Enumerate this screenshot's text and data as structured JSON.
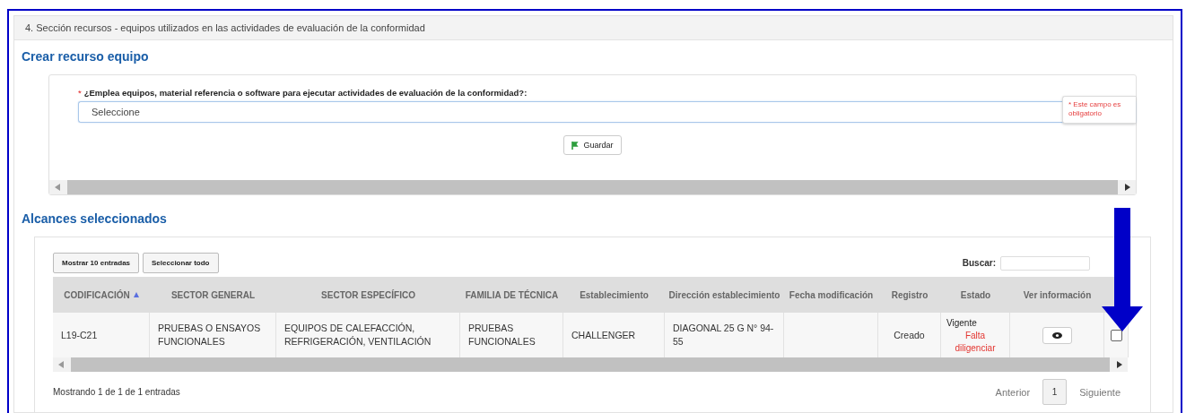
{
  "section": {
    "title": "4. Sección recursos - equipos utilizados en las actividades de evaluación de la conformidad"
  },
  "create": {
    "heading": "Crear recurso equipo",
    "question": {
      "label": "¿Emplea equipos, material referencia o software para ejecutar actividades de evaluación de la conformidad?:",
      "required": true,
      "required_mark": "*",
      "value": "Seleccione",
      "error": "* Este campo es obligatorio"
    },
    "save_button": "Guardar"
  },
  "scopes": {
    "heading": "Alcances seleccionados",
    "buttons": [
      "Mostrar 10 entradas",
      "Seleccionar todo"
    ],
    "search_label": "Buscar:",
    "columns": [
      {
        "label": "CODIFICACIÓN",
        "sorted": true
      },
      {
        "label": "SECTOR GENERAL",
        "sorted": false
      },
      {
        "label": "SECTOR ESPECÍFICO",
        "sorted": false
      },
      {
        "label": "FAMILIA DE TÉCNICA",
        "sorted": false
      },
      {
        "label": "Establecimiento",
        "sorted": false
      },
      {
        "label": "Dirección establecimiento",
        "sorted": false
      },
      {
        "label": "Fecha modificación",
        "sorted": false
      },
      {
        "label": "Registro",
        "sorted": false
      },
      {
        "label": "Estado",
        "sorted": false
      },
      {
        "label": "Ver información",
        "sorted": false
      }
    ],
    "rows": [
      {
        "cells": [
          "L19-C21",
          "PRUEBAS O ENSAYOS FUNCIONALES",
          "EQUIPOS DE CALEFACCIÓN, REFRIGERACIÓN, VENTILACIÓN",
          "PRUEBAS FUNCIONALES",
          "CHALLENGER",
          "DIAGONAL 25 G N° 94-55",
          "",
          "Creado"
        ],
        "status": "Vigente",
        "status_note": "Falta diligenciar",
        "checked": false
      }
    ],
    "info": "Mostrando 1 de 1 de 1 entradas",
    "pagination": {
      "previous": "Anterior",
      "pages": [
        {
          "label": "1",
          "selected": true
        }
      ],
      "next": "Siguiente"
    }
  }
}
